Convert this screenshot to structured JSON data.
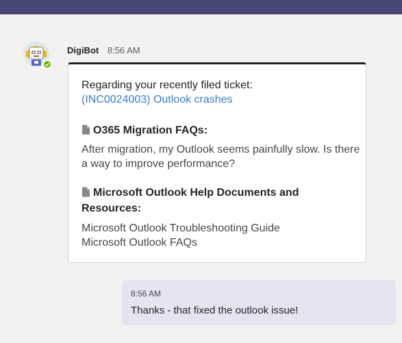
{
  "colors": {
    "top_bar": "#464775",
    "chat_background": "#f3f2f1",
    "link": "#3a7ccf",
    "my_bubble": "#e5e5f1",
    "status_available": "#6bb700"
  },
  "bot_message": {
    "sender": "DigiBot",
    "time": "8:56 AM",
    "avatar_icon": "robot-avatar-icon",
    "status": "available",
    "card": {
      "intro": "Regarding your recently filed ticket:",
      "ticket_link": "(INC0024003) Outlook crashes",
      "sections": [
        {
          "icon": "document-icon",
          "title": "O365 Migration FAQs:",
          "items": [
            "After migration, my Outlook seems painfully slow. Is there a way to improve performance?"
          ]
        },
        {
          "icon": "document-icon",
          "title": "Microsoft Outlook Help Documents and Resources:",
          "items": [
            "Microsoft Outlook Troubleshooting Guide",
            "Microsoft Outlook FAQs"
          ]
        }
      ]
    }
  },
  "my_message": {
    "time": "8:56 AM",
    "text": "Thanks - that fixed the outlook issue!"
  }
}
